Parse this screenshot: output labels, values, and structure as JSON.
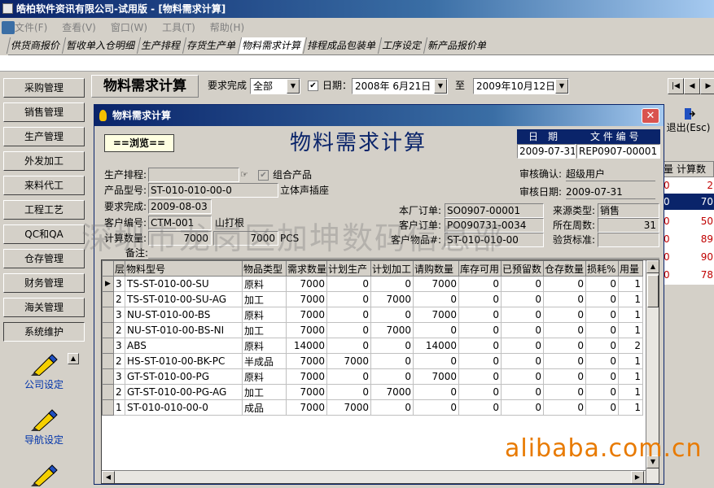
{
  "window": {
    "title": "皓柏软件资讯有限公司-试用版 - [物料需求计算]"
  },
  "menu": [
    "文件(F)",
    "查看(V)",
    "窗口(W)",
    "工具(T)",
    "帮助(H)"
  ],
  "tabs": [
    "供货商报价",
    "暂收单入仓明细",
    "生产排程",
    "存货生产单",
    "物料需求计算",
    "排程成品包装单",
    "工序设定",
    "新产品报价单"
  ],
  "nav": [
    "采购管理",
    "销售管理",
    "生产管理",
    "外发加工",
    "来料代工",
    "工程工艺",
    "QC和QA",
    "仓存管理",
    "财务管理",
    "海关管理",
    "系统维护"
  ],
  "nav_big": [
    "公司设定",
    "导航设定"
  ],
  "toolbar": {
    "page_title": "物料需求计算",
    "req_label": "要求完成",
    "req_value": "全部",
    "date_label": "日期：",
    "date_from": "2008年 6月21日",
    "to_label": "至",
    "date_to": "2009年10月12日",
    "exit_label": "退出(Esc)"
  },
  "bg_table": {
    "headers": [
      "量",
      "计算数"
    ],
    "values": [
      "2",
      "70",
      "50",
      "89",
      "90",
      "78"
    ]
  },
  "dialog": {
    "title": "物料需求计算",
    "browse": "==浏览==",
    "heading": "物料需求计算",
    "doc_head_date": "日　期",
    "doc_head_no": "文 件 编 号",
    "doc_date": "2009-07-31",
    "doc_no": "REP0907-00001",
    "prod_sched_label": "生产排程:",
    "combo_label": "组合产品",
    "audit_confirm_label": "审核确认:",
    "audit_confirm_value": "超级用户",
    "model_label": "产品型号:",
    "model_value": "ST-010-010-00-0",
    "model_desc": "立体声插座",
    "audit_date_label": "审核日期:",
    "audit_date_value": "2009-07-31",
    "req_done_label": "要求完成:",
    "req_done_value": "2009-08-03",
    "factory_order_label": "本厂订单:",
    "factory_order_value": "SO0907-00001",
    "source_label": "来源类型:",
    "source_value": "销售",
    "cust_no_label": "客户编号:",
    "cust_no_value": "CTM-001",
    "cust_name": "山打根",
    "cust_order_label": "客户订单:",
    "cust_order_value": "PO090731-0034",
    "week_label": "所在周数:",
    "week_value": "31",
    "calc_qty_label": "计算数量:",
    "calc_qty_1": "7000",
    "calc_qty_2": "7000",
    "unit": "PCS",
    "cust_item_label": "客户物品#:",
    "cust_item_value": "ST-010-010-00",
    "inspect_label": "验货标准:",
    "remark_label": "备注:"
  },
  "grid": {
    "columns": [
      "层",
      "物料型号",
      "物品类型",
      "需求数量",
      "计划生产",
      "计划加工",
      "请购数量",
      "库存可用",
      "已预留数",
      "仓存数量",
      "损耗%",
      "用量"
    ],
    "rows": [
      [
        "3",
        "TS-ST-010-00-SU",
        "原料",
        "7000",
        "0",
        "0",
        "7000",
        "0",
        "0",
        "0",
        "0",
        "1"
      ],
      [
        "2",
        "TS-ST-010-00-SU-AG",
        "加工",
        "7000",
        "0",
        "7000",
        "0",
        "0",
        "0",
        "0",
        "0",
        "1"
      ],
      [
        "3",
        "NU-ST-010-00-BS",
        "原料",
        "7000",
        "0",
        "0",
        "7000",
        "0",
        "0",
        "0",
        "0",
        "1"
      ],
      [
        "2",
        "NU-ST-010-00-BS-NI",
        "加工",
        "7000",
        "0",
        "7000",
        "0",
        "0",
        "0",
        "0",
        "0",
        "1"
      ],
      [
        "3",
        "ABS",
        "原料",
        "14000",
        "0",
        "0",
        "14000",
        "0",
        "0",
        "0",
        "0",
        "2"
      ],
      [
        "2",
        "HS-ST-010-00-BK-PC",
        "半成品",
        "7000",
        "7000",
        "0",
        "0",
        "0",
        "0",
        "0",
        "0",
        "1"
      ],
      [
        "3",
        "GT-ST-010-00-PG",
        "原料",
        "7000",
        "0",
        "0",
        "7000",
        "0",
        "0",
        "0",
        "0",
        "1"
      ],
      [
        "2",
        "GT-ST-010-00-PG-AG",
        "加工",
        "7000",
        "0",
        "7000",
        "0",
        "0",
        "0",
        "0",
        "0",
        "1"
      ],
      [
        "1",
        "ST-010-010-00-0",
        "成品",
        "7000",
        "7000",
        "0",
        "0",
        "0",
        "0",
        "0",
        "0",
        "1"
      ]
    ]
  },
  "watermark": "深圳市龙岗区加坤数码信息部",
  "alibaba": "alibaba.com.cn"
}
